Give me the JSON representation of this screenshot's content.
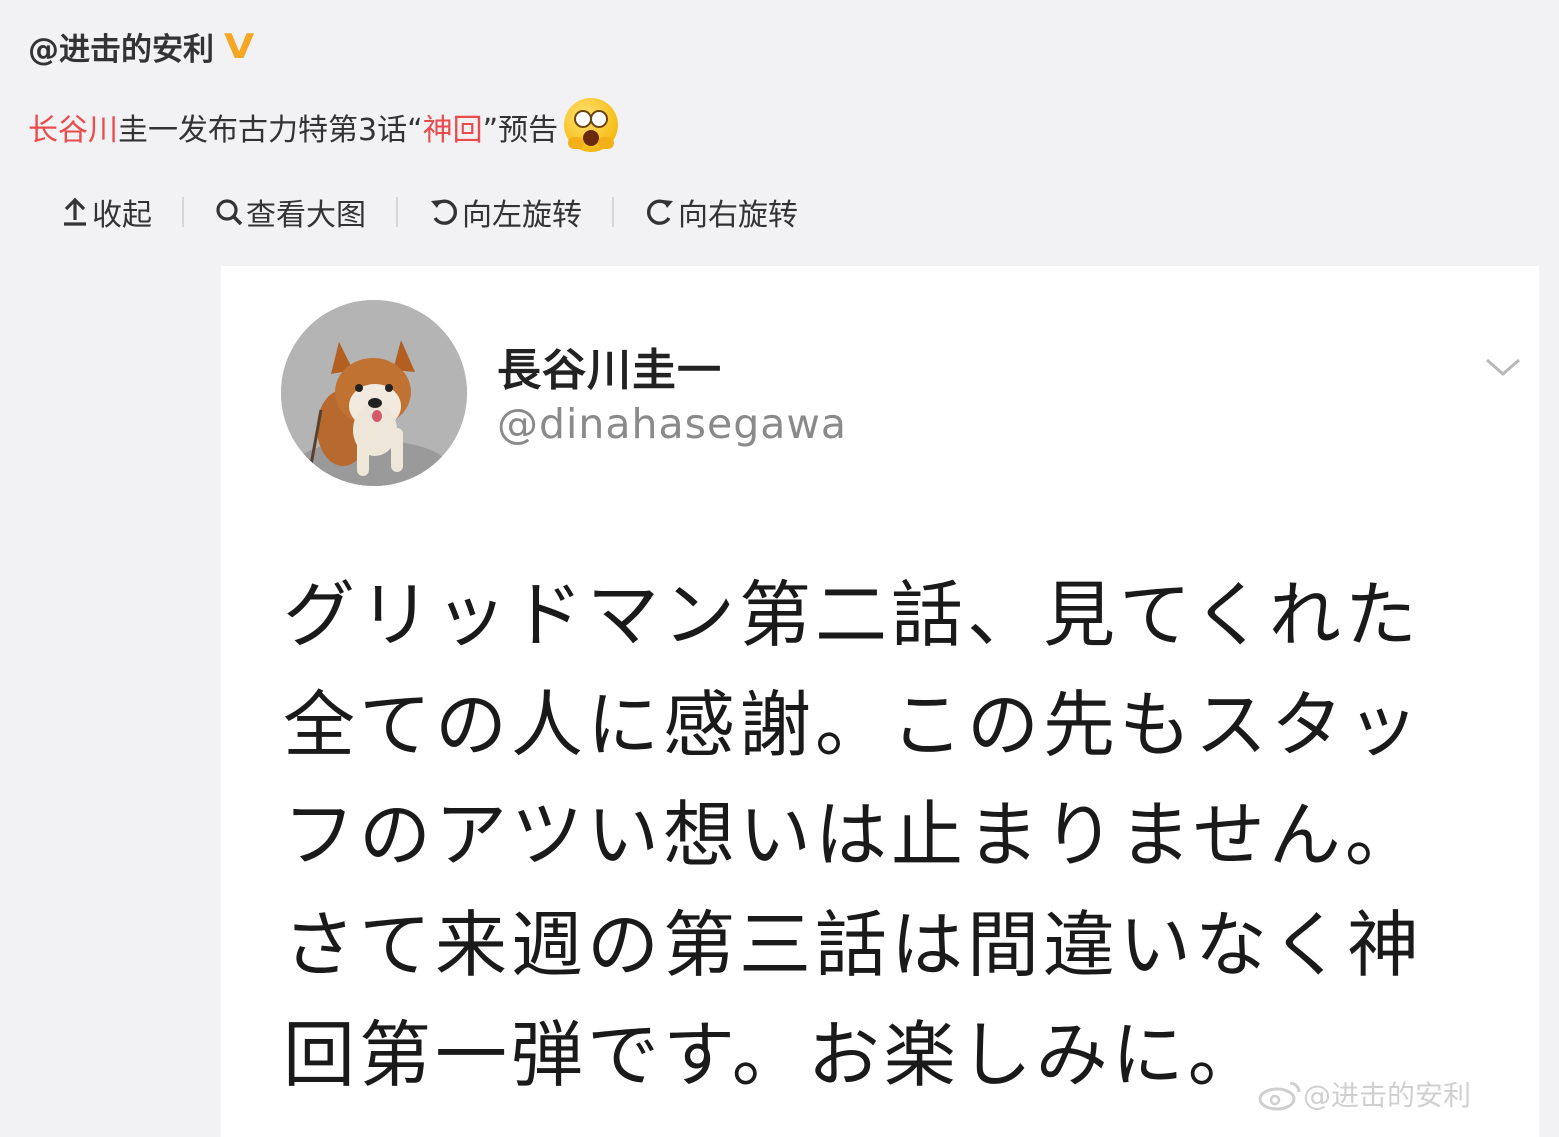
{
  "post": {
    "author": "@进击的安利",
    "verified_mark": "V",
    "text": {
      "topic": "长谷川",
      "middle": "圭一发布古力特第3话“",
      "highlight": "神回",
      "tail": "”预告"
    },
    "emoji": "scream-emoji"
  },
  "toolbar": {
    "collapse": "收起",
    "view_large": "查看大图",
    "rotate_left": "向左旋转",
    "rotate_right": "向右旋转"
  },
  "tweet": {
    "name": "長谷川圭一",
    "handle": "@dinahasegawa",
    "lines": [
      "グリッドマン第二話、見てくれた",
      "全ての人に感謝。この先もスタッ",
      "フのアツい想いは止まりません。",
      "さて来週の第三話は間違いなく神",
      "回第一弾です。お楽しみに。"
    ]
  },
  "watermark": "@进击的安利",
  "colors": {
    "background": "#f2f2f5",
    "highlight": "#eb4b4b",
    "verified": "#f5a623",
    "handle": "#8a8a8a"
  }
}
